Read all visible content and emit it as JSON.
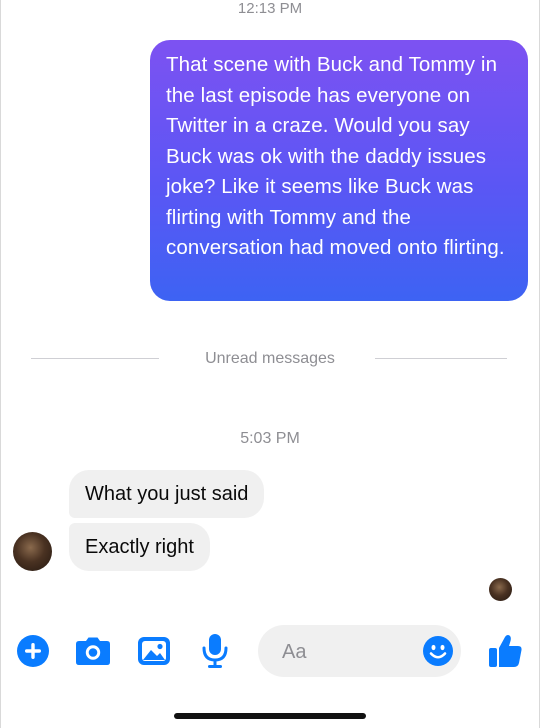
{
  "conversation": {
    "timestamp_1": "12:13 PM",
    "outgoing_message": "That scene with Buck and Tommy in the last episode has everyone on Twitter in a craze. Would you say Buck was ok with the daddy issues joke? Like it seems like Buck was flirting with Tommy and the conversation had moved onto flirting.",
    "unread_divider": "Unread messages",
    "timestamp_2": "5:03 PM",
    "incoming_messages": [
      "What you just said",
      "Exactly right"
    ]
  },
  "composer": {
    "placeholder": "Aa"
  },
  "toolbar": {
    "icons": [
      "plus-icon",
      "camera-icon",
      "image-icon",
      "microphone-icon",
      "emoji-icon",
      "thumbs-up-icon"
    ]
  },
  "colors": {
    "accent": "#0a7cff",
    "bubble_gradient_top": "#7d52f2",
    "bubble_gradient_bottom": "#3d63f3",
    "incoming_bubble": "#f0f0f0",
    "meta_text": "#8e8e93"
  }
}
